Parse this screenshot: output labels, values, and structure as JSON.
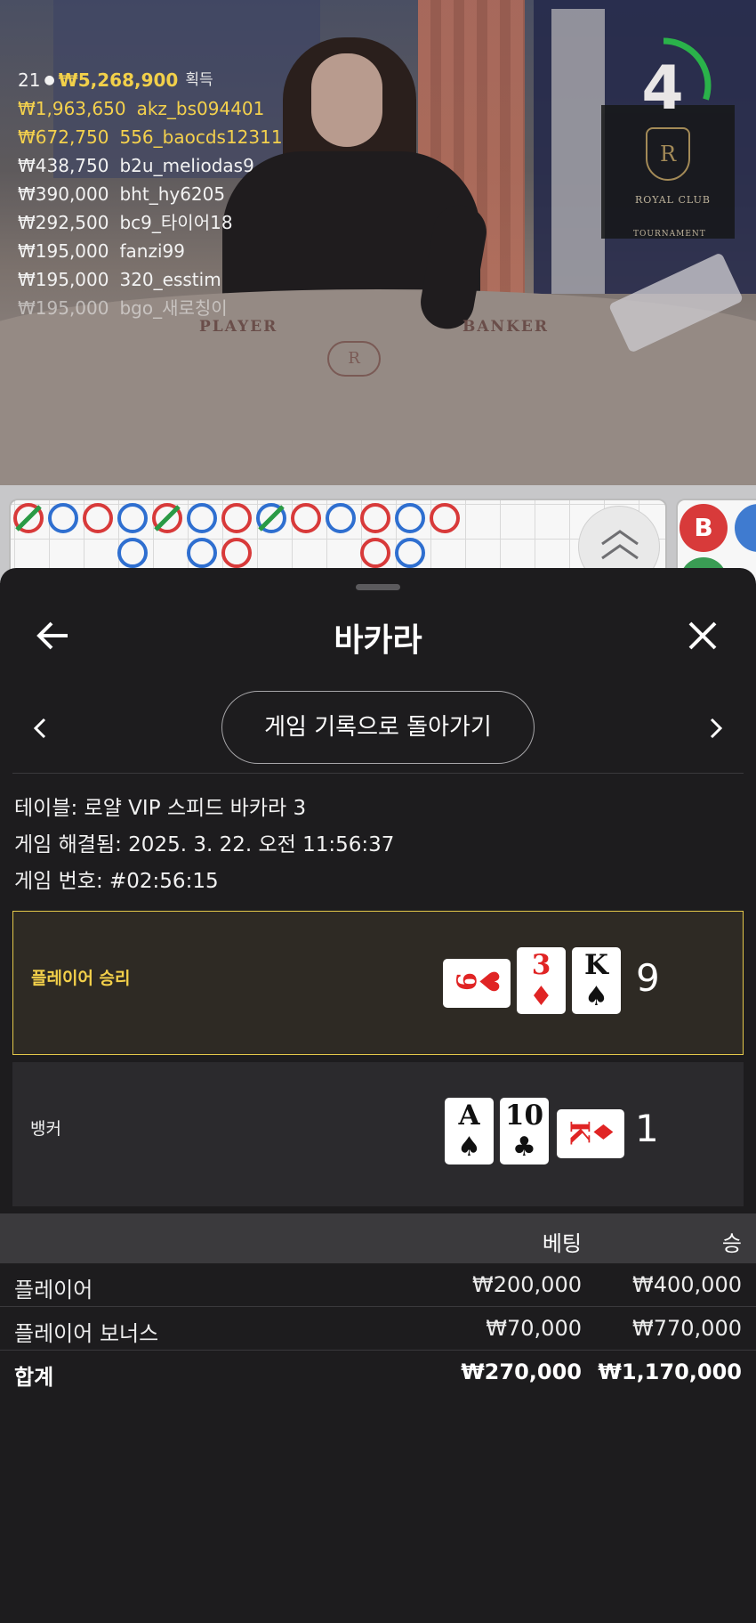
{
  "stream": {
    "player_table_label": "PLAYER",
    "banker_table_label": "BANKER",
    "logo_letter": "R",
    "countdown": "4",
    "countdown_fraction": 0.3,
    "royal_club": "ROYAL CLUB",
    "tournament": "TOURNAMENT"
  },
  "winners": {
    "count": "21",
    "total": "₩5,268,900",
    "label": "획득",
    "list": [
      {
        "amount": "₩1,963,650",
        "name": "akz_bs094401",
        "style": "gold"
      },
      {
        "amount": "₩672,750",
        "name": "556_baocds12311",
        "style": "gold"
      },
      {
        "amount": "₩438,750",
        "name": "b2u_meliodas9",
        "style": "white"
      },
      {
        "amount": "₩390,000",
        "name": "bht_hy6205",
        "style": "white"
      },
      {
        "amount": "₩292,500",
        "name": "bc9_타이어18",
        "style": "white"
      },
      {
        "amount": "₩195,000",
        "name": "fanzi99",
        "style": "white"
      },
      {
        "amount": "₩195,000",
        "name": "320_esstim",
        "style": "white"
      },
      {
        "amount": "₩195,000",
        "name": "bgo_새로칭이",
        "style": "faded"
      }
    ]
  },
  "roads": {
    "badge_b": "B",
    "colors": {
      "banker": "#d83a3a",
      "player": "#2f6fd0",
      "tie": "#2a9a45"
    }
  },
  "sheet": {
    "title": "바카라",
    "back_icon": "arrow-left-icon",
    "close_icon": "close-icon",
    "record_button": "게임 기록으로 돌아가기",
    "table_line": "테이블: 로얄 VIP 스피드 바카라 3",
    "resolved_line": "게임 해결됨: 2025. 3. 22. 오전 11:56:37",
    "round_line": "게임 번호: #02:56:15"
  },
  "results": {
    "player": {
      "label": "플레이어 승리",
      "score": "9",
      "cards": [
        {
          "rank": "9",
          "suit": "♥",
          "color": "red",
          "orientation": "side"
        },
        {
          "rank": "3",
          "suit": "♦",
          "color": "red",
          "orientation": "up"
        },
        {
          "rank": "K",
          "suit": "♠",
          "color": "black",
          "orientation": "up"
        }
      ]
    },
    "banker": {
      "label": "뱅커",
      "score": "1",
      "cards": [
        {
          "rank": "A",
          "suit": "♠",
          "color": "black",
          "orientation": "up"
        },
        {
          "rank": "10",
          "suit": "♣",
          "color": "black",
          "orientation": "up"
        },
        {
          "rank": "K",
          "suit": "♦",
          "color": "red",
          "orientation": "side"
        }
      ]
    }
  },
  "bets": {
    "headers": [
      "",
      "베팅",
      "승"
    ],
    "rows": [
      {
        "name": "플레이어",
        "bet": "₩200,000",
        "win": "₩400,000"
      },
      {
        "name": "플레이어 보너스",
        "bet": "₩70,000",
        "win": "₩770,000"
      }
    ],
    "total": {
      "name": "합계",
      "bet": "₩270,000",
      "win": "₩1,170,000"
    }
  }
}
